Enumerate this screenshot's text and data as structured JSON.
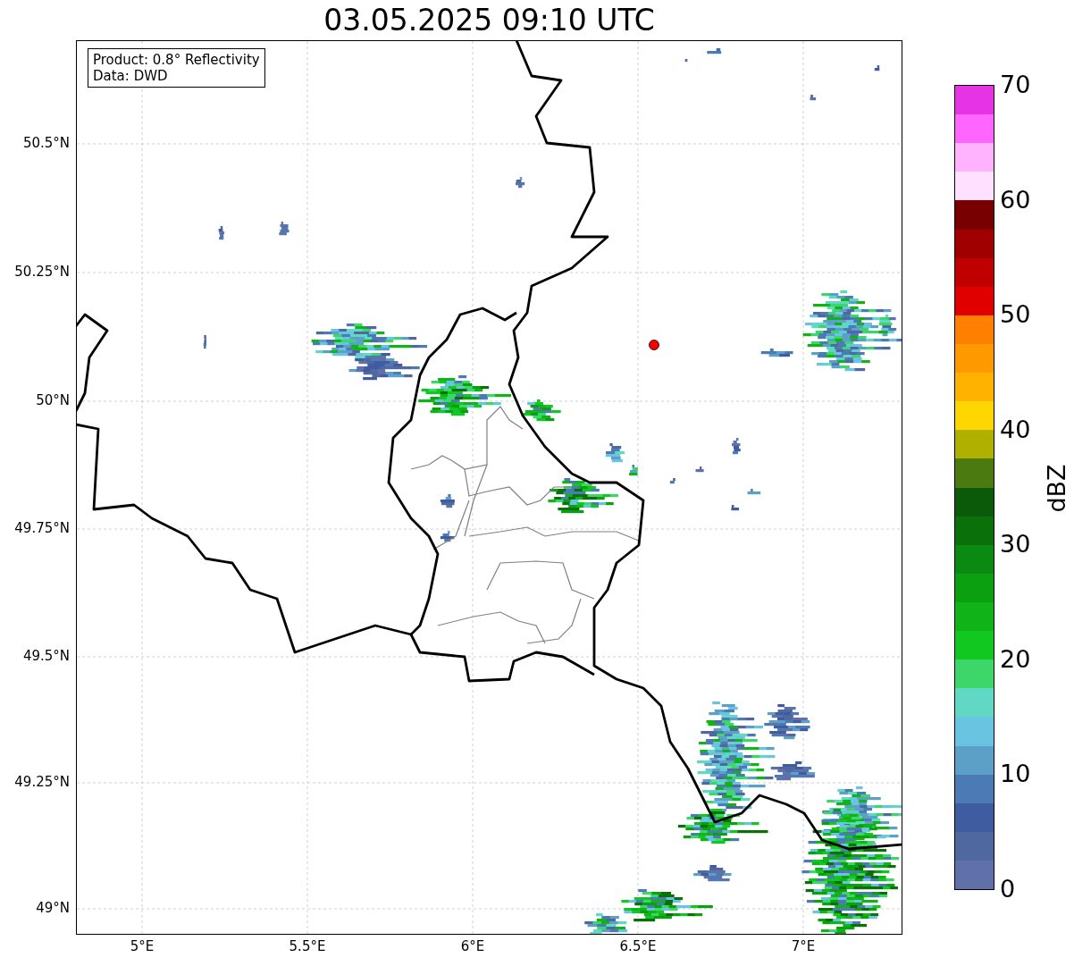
{
  "title": "03.05.2025 09:10 UTC",
  "info_box": {
    "lines": [
      "Product: 0.8° Reflectivity",
      "Data: DWD"
    ]
  },
  "y_ticks": [
    "50.5°N",
    "50.25°N",
    "50°N",
    "49.75°N",
    "49.5°N",
    "49.25°N",
    "49°N"
  ],
  "x_ticks": [
    "5°E",
    "5.5°E",
    "6°E",
    "6.5°E",
    "7°E"
  ],
  "colorbar": {
    "label": "dBZ",
    "ticks": [
      "70",
      "60",
      "50",
      "40",
      "30",
      "20",
      "10",
      "0"
    ],
    "segments": [
      {
        "color": "#e633e6"
      },
      {
        "color": "#ff66ff"
      },
      {
        "color": "#ffb3ff"
      },
      {
        "color": "#ffe0ff"
      },
      {
        "color": "#780000"
      },
      {
        "color": "#a00000"
      },
      {
        "color": "#c00000"
      },
      {
        "color": "#e00000"
      },
      {
        "color": "#ff7f00"
      },
      {
        "color": "#ff9900"
      },
      {
        "color": "#ffb300"
      },
      {
        "color": "#ffd700"
      },
      {
        "color": "#b0b000"
      },
      {
        "color": "#4a7a10"
      },
      {
        "color": "#0a5a0a"
      },
      {
        "color": "#0a700a"
      },
      {
        "color": "#0a8a10"
      },
      {
        "color": "#0aa010"
      },
      {
        "color": "#10b418"
      },
      {
        "color": "#10c820"
      },
      {
        "color": "#3cd66a"
      },
      {
        "color": "#60d8c4"
      },
      {
        "color": "#68c4e0"
      },
      {
        "color": "#5ca0c8"
      },
      {
        "color": "#4c7ab4"
      },
      {
        "color": "#405ca0"
      },
      {
        "color": "#5068a0"
      },
      {
        "color": "#6070a8"
      }
    ]
  }
}
